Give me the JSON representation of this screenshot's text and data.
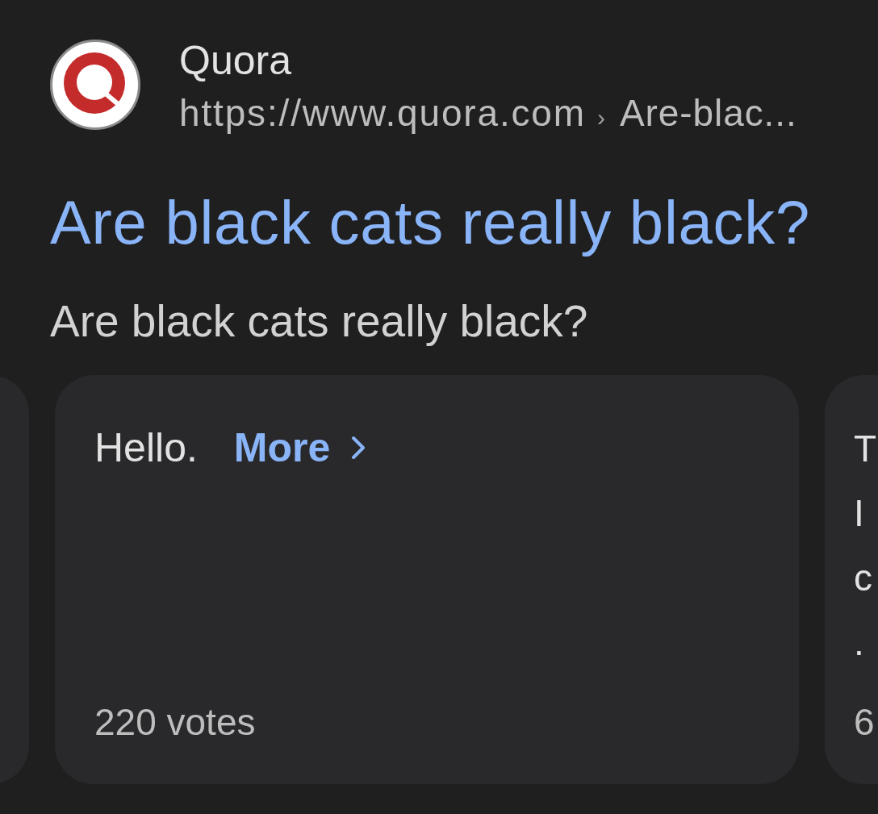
{
  "result": {
    "site_name": "Quora",
    "url": "https://www.quora.com",
    "separator": "›",
    "breadcrumb": "Are-blac...",
    "title": "Are black cats really black?",
    "snippet": "Are black cats really black?"
  },
  "answer_cards": [
    {
      "kind": "edge"
    },
    {
      "kind": "full",
      "text": "Hello.",
      "more_label": "More",
      "votes": "220 votes"
    },
    {
      "kind": "cut",
      "lines": [
        "T",
        "I",
        "c",
        "."
      ],
      "votes": "6"
    }
  ]
}
